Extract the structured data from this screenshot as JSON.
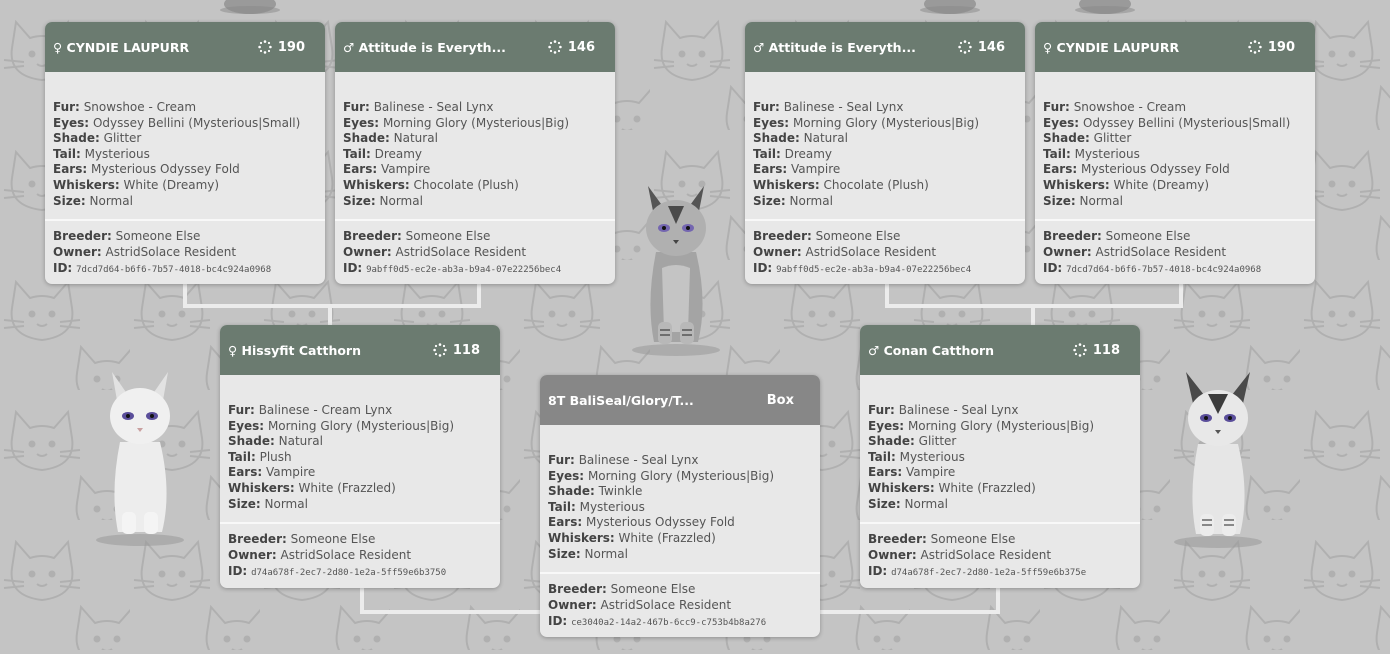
{
  "labels": {
    "fur": "Fur:",
    "eyes": "Eyes:",
    "shade": "Shade:",
    "tail": "Tail:",
    "ears": "Ears:",
    "whiskers": "Whiskers:",
    "size": "Size:",
    "breeder": "Breeder:",
    "owner": "Owner:",
    "id": "ID:"
  },
  "colors": {
    "header_green": "#6b7b70",
    "header_gray": "#878787",
    "card_bg": "#e8e8e8",
    "page_bg": "#c4c4c4"
  },
  "cards": {
    "gp1": {
      "sex_symbol": "♀",
      "name": "CYNDIE LAUPURR",
      "generation": "190",
      "fur": "Snowshoe - Cream",
      "eyes": "Odyssey Bellini (Mysterious|Small)",
      "shade": "Glitter",
      "tail": "Mysterious",
      "ears": "Mysterious Odyssey Fold",
      "whiskers": "White (Dreamy)",
      "size": "Normal",
      "breeder": "Someone Else",
      "owner": "AstridSolace Resident",
      "id": "7dcd7d64-b6f6-7b57-4018-bc4c924a0968"
    },
    "gp2": {
      "sex_symbol": "♂",
      "name": "Attitude is Everyth...",
      "generation": "146",
      "fur": "Balinese - Seal Lynx",
      "eyes": "Morning Glory (Mysterious|Big)",
      "shade": "Natural",
      "tail": "Dreamy",
      "ears": "Vampire",
      "whiskers": "Chocolate (Plush)",
      "size": "Normal",
      "breeder": "Someone Else",
      "owner": "AstridSolace Resident",
      "id": "9abff0d5-ec2e-ab3a-b9a4-07e22256bec4"
    },
    "gp3": {
      "sex_symbol": "♂",
      "name": "Attitude is Everyth...",
      "generation": "146",
      "fur": "Balinese - Seal Lynx",
      "eyes": "Morning Glory (Mysterious|Big)",
      "shade": "Natural",
      "tail": "Dreamy",
      "ears": "Vampire",
      "whiskers": "Chocolate (Plush)",
      "size": "Normal",
      "breeder": "Someone Else",
      "owner": "AstridSolace Resident",
      "id": "9abff0d5-ec2e-ab3a-b9a4-07e22256bec4"
    },
    "gp4": {
      "sex_symbol": "♀",
      "name": "CYNDIE LAUPURR",
      "generation": "190",
      "fur": "Snowshoe - Cream",
      "eyes": "Odyssey Bellini (Mysterious|Small)",
      "shade": "Glitter",
      "tail": "Mysterious",
      "ears": "Mysterious Odyssey Fold",
      "whiskers": "White (Dreamy)",
      "size": "Normal",
      "breeder": "Someone Else",
      "owner": "AstridSolace Resident",
      "id": "7dcd7d64-b6f6-7b57-4018-bc4c924a0968"
    },
    "mother": {
      "sex_symbol": "♀",
      "name": "Hissyfit Catthorn",
      "generation": "118",
      "fur": "Balinese - Cream Lynx",
      "eyes": "Morning Glory (Mysterious|Big)",
      "shade": "Natural",
      "tail": "Plush",
      "ears": "Vampire",
      "whiskers": "White (Frazzled)",
      "size": "Normal",
      "breeder": "Someone Else",
      "owner": "AstridSolace Resident",
      "id": "d74a678f-2ec7-2d80-1e2a-5ff59e6b3750"
    },
    "father": {
      "sex_symbol": "♂",
      "name": "Conan Catthorn",
      "generation": "118",
      "fur": "Balinese - Seal Lynx",
      "eyes": "Morning Glory (Mysterious|Big)",
      "shade": "Glitter",
      "tail": "Mysterious",
      "ears": "Vampire",
      "whiskers": "White (Frazzled)",
      "size": "Normal",
      "breeder": "Someone Else",
      "owner": "AstridSolace Resident",
      "id": "d74a678f-2ec7-2d80-1e2a-5ff59e6b375e"
    },
    "box": {
      "name": "8T BaliSeal/Glory/T...",
      "status": "Box",
      "fur": "Balinese - Seal Lynx",
      "eyes": "Morning Glory (Mysterious|Big)",
      "shade": "Twinkle",
      "tail": "Mysterious",
      "ears": "Mysterious Odyssey Fold",
      "whiskers": "White (Frazzled)",
      "size": "Normal",
      "breeder": "Someone Else",
      "owner": "AstridSolace Resident",
      "id": "ce3040a2-14a2-467b-6cc9-c753b4b8a276"
    }
  }
}
